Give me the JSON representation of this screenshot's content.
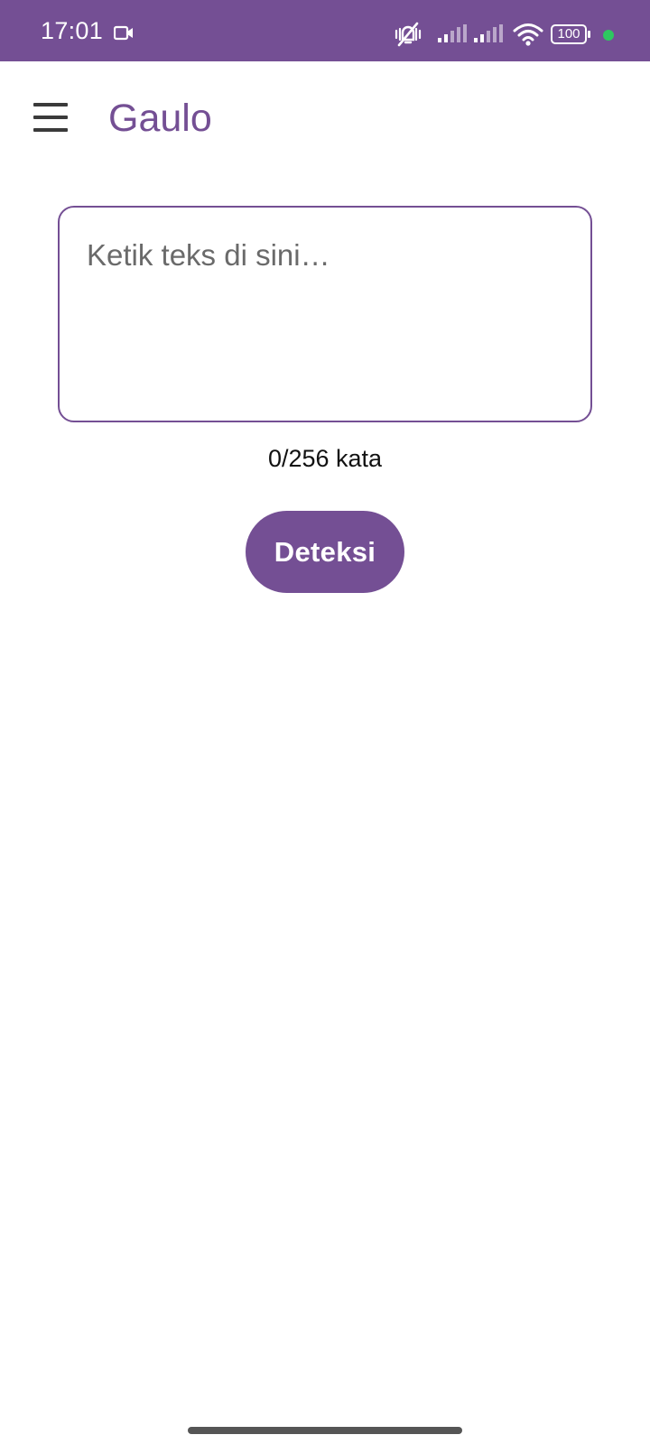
{
  "status_bar": {
    "time": "17:01",
    "icons": [
      "video-camera-icon",
      "vibrate-silent-icon",
      "signal-icon",
      "signal-icon",
      "wifi-icon",
      "battery-icon",
      "privacy-dot-icon"
    ],
    "battery_level": "100",
    "background_color": "#744f94",
    "privacy_dot_color": "#2ec760"
  },
  "app_bar": {
    "menu_icon": "hamburger-menu-icon",
    "title": "Gaulo",
    "title_color": "#744f94"
  },
  "input": {
    "value": "",
    "placeholder": "Ketik teks di sini…"
  },
  "counter": {
    "text": "0/256 kata"
  },
  "actions": {
    "detect_label": "Deteksi",
    "accent_color": "#744f94"
  }
}
